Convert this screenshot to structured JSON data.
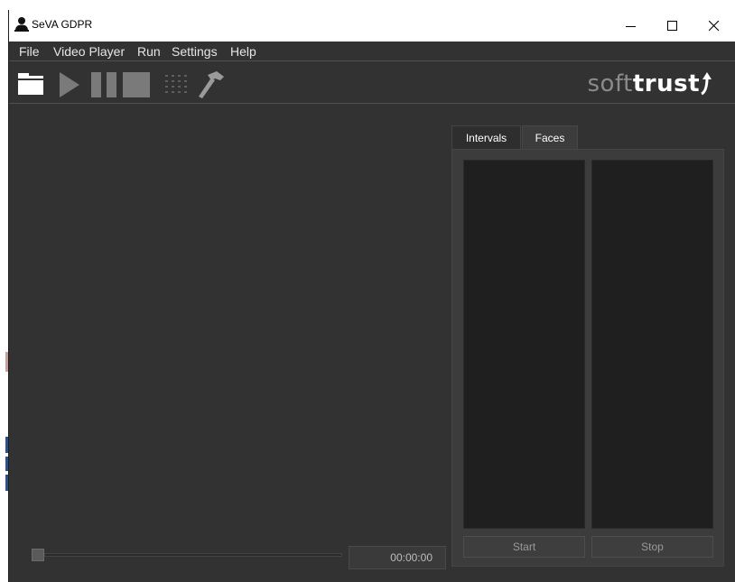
{
  "window": {
    "title": "SeVA GDPR",
    "controls": {
      "minimize": "minimize-icon",
      "maximize": "maximize-icon",
      "close": "close-icon"
    }
  },
  "menu": {
    "items": [
      "File",
      "Video Player",
      "Run",
      "Settings",
      "Help"
    ]
  },
  "toolbar": {
    "buttons": [
      "folder-open-icon",
      "play-icon",
      "pause-icon",
      "stop-icon",
      "grid-dots-icon",
      "hammer-icon"
    ],
    "brand_soft": "soft",
    "brand_trust": "trust"
  },
  "player": {
    "time": "00:00:00",
    "position": 0
  },
  "panel": {
    "tabs": [
      {
        "label": "Intervals",
        "active": true
      },
      {
        "label": "Faces",
        "active": false
      }
    ],
    "start_label": "Start",
    "stop_label": "Stop"
  },
  "colors": {
    "background": "#323232",
    "list_background": "#1f1f1f",
    "brand_soft": "#8b8b8b",
    "brand_trust": "#ffffff"
  }
}
